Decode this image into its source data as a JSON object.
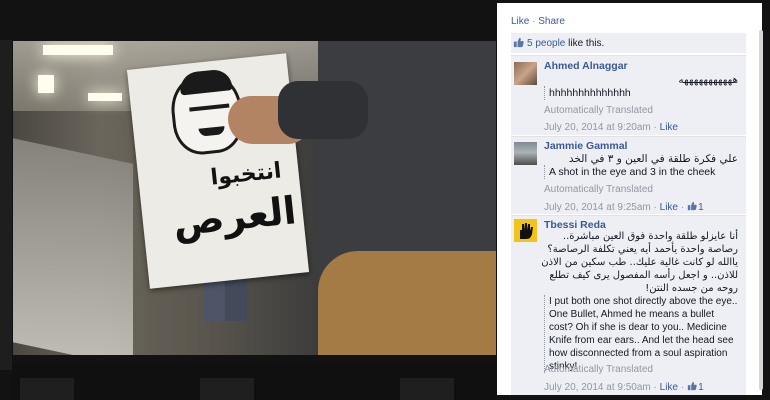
{
  "close_glyph": "×",
  "panel": {
    "top_actions": {
      "like": "Like",
      "separator": " · ",
      "share": "Share"
    },
    "likes": {
      "count_link": "5 people",
      "suffix": " like this."
    },
    "comments": [
      {
        "author": "Ahmed Alnaggar",
        "text_original": "هههههههههههه",
        "text_translated": "hhhhhhhhhhhhhh",
        "auto_label": "Automatically Translated",
        "timestamp": "July 20, 2014 at 9:20am",
        "like_label": "Like"
      },
      {
        "author": "Jammie Gammal",
        "text_original": "علي فكرة طلقة في العين و ٣ في الخد",
        "text_translated": "A shot in the eye and 3 in the cheek",
        "auto_label": "Automatically Translated",
        "timestamp": "July 20, 2014 at 9:25am",
        "like_label": "Like",
        "like_count": "1"
      },
      {
        "author": "Tbessi Reda",
        "text_original": "أنا عايزلو طلقة واحدة فوق العين مباشرة.. رصاصة واحدة يأحمد أيه يعني تكلفة الرصاصة؟ ياالله لو كانت غالية عليك.. طب سكين من الاذن للاذن.. و اجعل رأسه المفصول يرى كيف تطلع روحه من جسده النتن!",
        "text_translated": "I put both one shot directly above the eye.. One Bullet, Ahmed he means a bullet cost? Oh if she is dear to you.. Medicine Knife from ear ears.. And let the head see how disconnected from a soul aspiration stinky!",
        "auto_label": "Automatically Translated",
        "timestamp": "July 20, 2014 at 9:50am",
        "like_label": "Like",
        "like_count": "1"
      }
    ]
  },
  "media": {
    "sign_line1": "انتخبوا",
    "sign_line2": "العرص"
  },
  "colors": {
    "link": "#3b5998",
    "panel_bg": "#edeff4",
    "muted": "#9197a3"
  }
}
